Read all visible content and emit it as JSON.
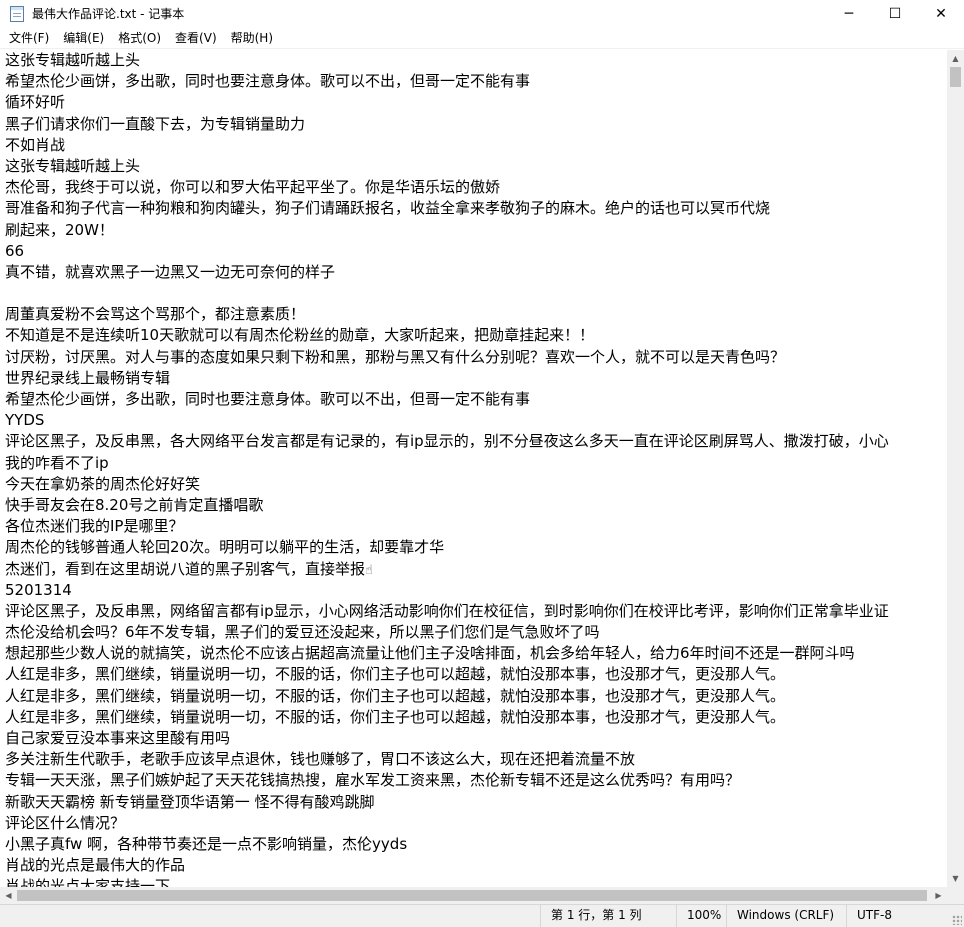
{
  "window": {
    "title": "最伟大作品评论.txt - 记事本",
    "icon": "notepad-icon",
    "minimize_glyph": "─",
    "maximize_glyph": "☐",
    "close_glyph": "✕"
  },
  "menu": [
    {
      "label": "文件(F)"
    },
    {
      "label": "编辑(E)"
    },
    {
      "label": "格式(O)"
    },
    {
      "label": "查看(V)"
    },
    {
      "label": "帮助(H)"
    }
  ],
  "lines": [
    "这张专辑越听越上头",
    "希望杰伦少画饼，多出歌，同时也要注意身体。歌可以不出，但哥一定不能有事",
    "循环好听",
    "黑子们请求你们一直酸下去，为专辑销量助力",
    "不如肖战",
    "这张专辑越听越上头",
    "杰伦哥，我终于可以说，你可以和罗大佑平起平坐了。你是华语乐坛的傲娇",
    "哥准备和狗子代言一种狗粮和狗肉罐头，狗子们请踊跃报名，收益全拿来孝敬狗子的麻木。绝户的话也可以冥币代烧",
    "刷起来，20W！",
    "66",
    "真不错，就喜欢黑子一边黑又一边无可奈何的样子",
    "",
    "周董真爱粉不会骂这个骂那个，都注意素质！",
    "不知道是不是连续听10天歌就可以有周杰伦粉丝的勋章，大家听起来，把勋章挂起来！！",
    "讨厌粉，讨厌黑。对人与事的态度如果只剩下粉和黑，那粉与黑又有什么分别呢？喜欢一个人，就不可以是天青色吗？",
    "世界纪录线上最畅销专辑",
    "希望杰伦少画饼，多出歌，同时也要注意身体。歌可以不出，但哥一定不能有事",
    "YYDS",
    "评论区黑子，及反串黑，各大网络平台发言都是有记录的，有ip显示的，别不分昼夜这么多天一直在评论区刷屏骂人、撒泼打破，小心",
    "我的咋看不了ip",
    "今天在拿奶茶的周杰伦好好笑",
    "快手哥友会在8.20号之前肯定直播唱歌",
    "各位杰迷们我的IP是哪里？",
    "周杰伦的钱够普通人轮回20次。明明可以躺平的生活，却要靠才华",
    "杰迷们，看到在这里胡说八道的黑子别客气，直接举报",
    "5201314",
    "评论区黑子，及反串黑，网络留言都有ip显示，小心网络活动影响你们在校征信，到时影响你们在校评比考评，影响你们正常拿毕业证",
    "杰伦没给机会吗？6年不发专辑，黑子们的爱豆还没起来，所以黑子们您们是气急败坏了吗",
    "想起那些少数人说的就搞笑，说杰伦不应该占据超高流量让他们主子没啥排面，机会多给年轻人，给力6年时间不还是一群阿斗吗",
    "人红是非多，黑们继续，销量说明一切，不服的话，你们主子也可以超越，就怕没那本事，也没那才气，更没那人气。",
    "人红是非多，黑们继续，销量说明一切，不服的话，你们主子也可以超越，就怕没那本事，也没那才气，更没那人气。",
    "人红是非多，黑们继续，销量说明一切，不服的话，你们主子也可以超越，就怕没那本事，也没那才气，更没那人气。",
    "自己家爱豆没本事来这里酸有用吗",
    "多关注新生代歌手，老歌手应该早点退休，钱也赚够了，胃口不该这么大，现在还把着流量不放",
    "专辑一天天涨，黑子们嫉妒起了天天花钱搞热搜，雇水军发工资来黑，杰伦新专辑不还是这么优秀吗？有用吗？",
    "新歌天天霸榜 新专销量登顶华语第一 怪不得有酸鸡跳脚",
    "评论区什么情况？",
    "小黑子真fw 啊，各种带节奏还是一点不影响销量，杰伦yyds",
    "肖战的光点是最伟大的作品",
    "肖战的光点大家支持一下"
  ],
  "emoji_glyph": "☝",
  "status": {
    "position": "第 1 行，第 1 列",
    "zoom": "100%",
    "line_ending": "Windows (CRLF)",
    "encoding": "UTF-8"
  }
}
